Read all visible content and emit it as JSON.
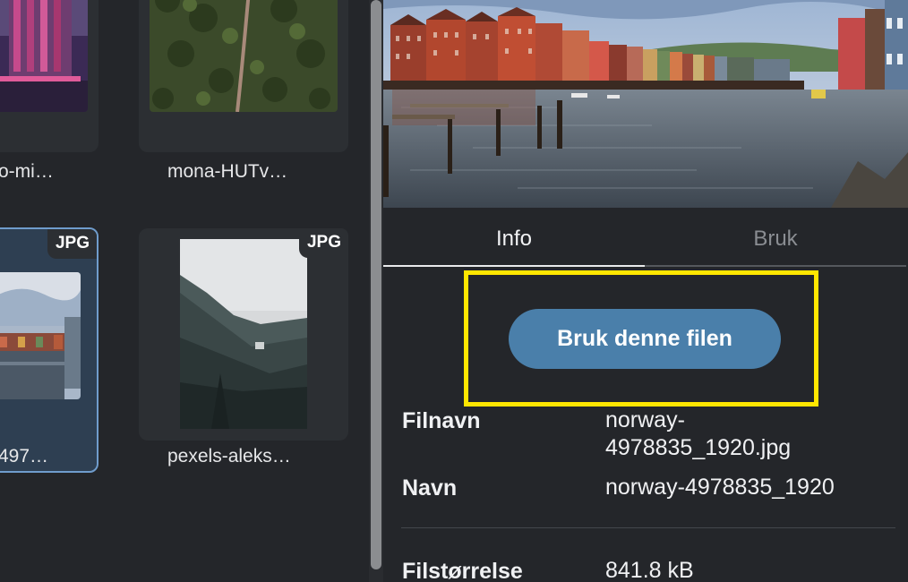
{
  "grid": {
    "cards": [
      {
        "label": "o-mi…"
      },
      {
        "label": "mona-HUTv…"
      },
      {
        "label": "497…",
        "badge": "JPG",
        "selected": true
      },
      {
        "label": "pexels-aleks…",
        "badge": "JPG"
      }
    ]
  },
  "detail": {
    "tabs": [
      {
        "label": "Info",
        "active": true
      },
      {
        "label": "Bruk",
        "active": false
      }
    ],
    "use_button": "Bruk denne filen",
    "fields": [
      {
        "label": "Filnavn",
        "value": "norway-4978835_1920.jpg"
      },
      {
        "label": "Navn",
        "value": "norway-4978835_1920"
      },
      {
        "label": "Filstørrelse",
        "value": "841.8 kB"
      }
    ]
  },
  "colors": {
    "background": "#24262a",
    "accent": "#4a7faa",
    "highlight": "#ffe600",
    "selected_border": "#6f9ccc"
  },
  "icons": []
}
